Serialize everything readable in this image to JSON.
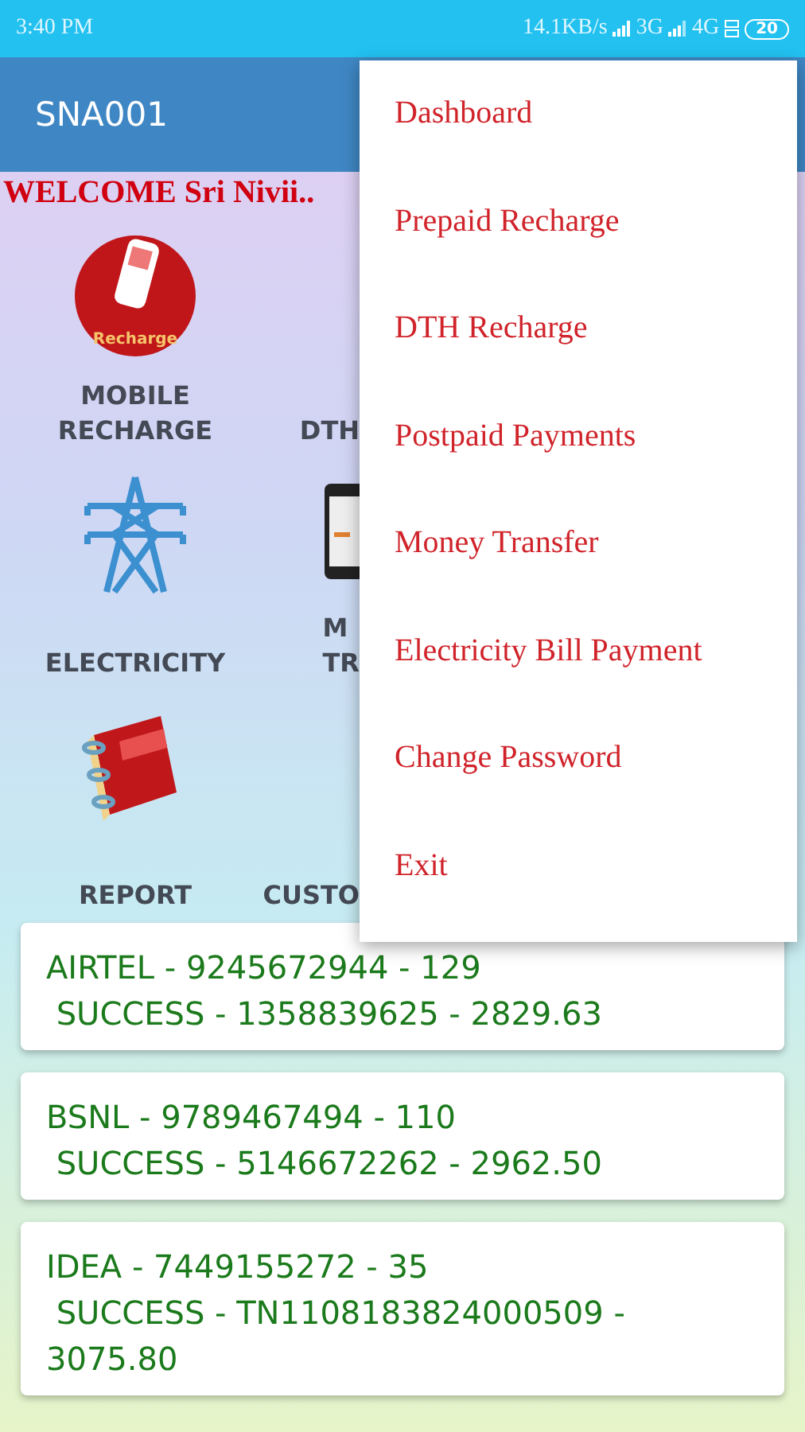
{
  "status_bar": {
    "time": "3:40 PM",
    "speed": "14.1KB/s",
    "network_1": "3G",
    "network_2": "4G",
    "battery": "20"
  },
  "app_bar": {
    "title": "SNA001"
  },
  "welcome": "WELCOME Sri Nivii..",
  "tiles": [
    {
      "kind": "mobile",
      "label": "MOBILE\nRECHARGE",
      "caption": "Recharge"
    },
    {
      "kind": "dth",
      "label": "DTH"
    },
    {
      "kind": "electricity",
      "label": "ELECTRICITY"
    },
    {
      "kind": "transfer",
      "label": "M\nTR"
    },
    {
      "kind": "report",
      "label": "REPORT"
    },
    {
      "kind": "customer",
      "label": "CUSTO"
    }
  ],
  "transactions": [
    {
      "line_1": "AIRTEL - 9245672944 - 129",
      "line_2": " SUCCESS - 1358839625 - 2829.63"
    },
    {
      "line_1": "BSNL - 9789467494 - 110",
      "line_2": " SUCCESS - 5146672262 - 2962.50"
    },
    {
      "line_1": "IDEA - 7449155272 - 35",
      "line_2": " SUCCESS - TN1108183824000509 - 3075.80"
    }
  ],
  "menu": [
    "Dashboard",
    "Prepaid Recharge",
    "DTH Recharge",
    "Postpaid Payments",
    "Money Transfer",
    "Electricity Bill Payment",
    "Change Password",
    "Exit"
  ]
}
